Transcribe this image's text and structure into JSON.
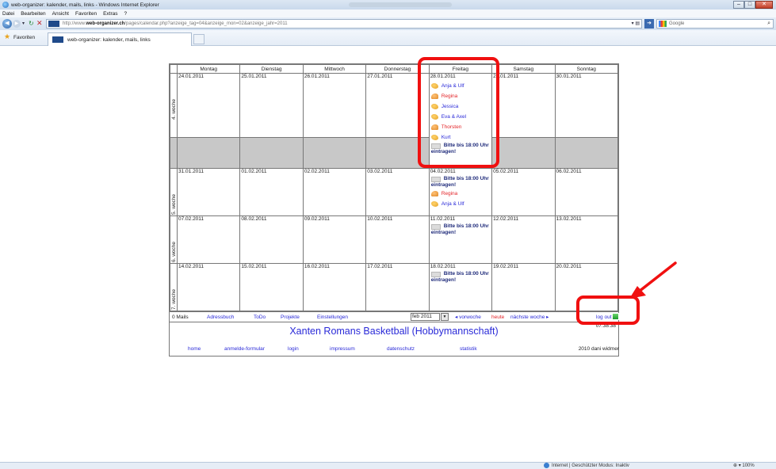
{
  "browser": {
    "window_title": "web-organizer: kalender, mails, links - Windows Internet Explorer",
    "menu": [
      "Datei",
      "Bearbeiten",
      "Ansicht",
      "Favoriten",
      "Extras",
      "?"
    ],
    "url_prefix": "http://www.",
    "url_domain": "web-organizer.ch",
    "url_path": "/pages/calendar.php?anzeige_tag=04&anzeige_mon=02&anzeige_jahr=2011",
    "search_provider": "Google",
    "favorites_label": "Favoriten",
    "tab_title": "web-organizer: kalender, mails, links",
    "status_zone": "Internet | Geschützter Modus: Inaktiv",
    "zoom": "100%"
  },
  "calendar": {
    "days": [
      "Montag",
      "Dienstag",
      "Mittwoch",
      "Donnerstag",
      "Freitag",
      "Samstag",
      "Sonntag"
    ],
    "weeks": [
      {
        "label": "4. woche",
        "dates": [
          "24.01.2011",
          "25.01.2011",
          "26.01.2011",
          "27.01.2011",
          "28.01.2011",
          "29.01.2011",
          "30.01.2011"
        ],
        "friday_entries": [
          {
            "text": "Anja & Ulf",
            "icon": "basketball-icon",
            "color": "#2a2ad8"
          },
          {
            "text": "Regina",
            "icon": "thumb-icon",
            "color": "#e3262a"
          },
          {
            "text": "Jessica",
            "icon": "basketball-icon",
            "color": "#2a2ad8"
          },
          {
            "text": "Eva & Axel",
            "icon": "basketball-icon",
            "color": "#2a2ad8"
          },
          {
            "text": "Thorsten",
            "icon": "thumb-icon",
            "color": "#e3262a"
          },
          {
            "text": "Kurt",
            "icon": "basketball-icon",
            "color": "#2a2ad8"
          }
        ],
        "friday_note_a": "Bitte bis 18:00 Uhr",
        "friday_note_b": "eintragen!"
      },
      {
        "label": "5. woche",
        "dates": [
          "31.01.2011",
          "01.02.2011",
          "02.02.2011",
          "03.02.2011",
          "04.02.2011",
          "05.02.2011",
          "06.02.2011"
        ],
        "friday_note_a": "Bitte bis 18:00 Uhr",
        "friday_note_b": "eintragen!",
        "friday_entries": [
          {
            "text": "Regina",
            "icon": "thumb-icon",
            "color": "#e3262a"
          },
          {
            "text": "Anja & Ulf",
            "icon": "basketball-icon",
            "color": "#2a2ad8"
          }
        ]
      },
      {
        "label": "6. woche",
        "dates": [
          "07.02.2011",
          "08.02.2011",
          "09.02.2011",
          "10.02.2011",
          "11.02.2011",
          "12.02.2011",
          "13.02.2011"
        ],
        "friday_note_a": "Bitte bis 18:00 Uhr",
        "friday_note_b": "eintragen!"
      },
      {
        "label": "7. woche",
        "dates": [
          "14.02.2011",
          "15.02.2011",
          "16.02.2011",
          "17.02.2011",
          "18.02.2011",
          "19.02.2011",
          "20.02.2011"
        ],
        "friday_note_a": "Bitte bis 18:00 Uhr",
        "friday_note_b": "eintragen!"
      }
    ]
  },
  "bottombar": {
    "mails": "0 Mails",
    "adressbuch": "Adressbuch",
    "todo": "ToDo",
    "projekte": "Projekte",
    "einstellungen": "Einstellungen",
    "month_select": "feb 2011",
    "vorwoche": "◂ vorwoche",
    "heute": "heute",
    "naechste": "nächste woche ▸",
    "logout": "log out",
    "time": "07:38:38"
  },
  "banner": "Xanten Romans Basketball (Hobbymannschaft)",
  "footer": {
    "home": "home",
    "anmelde": "anmelde-formular",
    "login": "login",
    "impressum": "impressum",
    "datenschutz": "datenschutz",
    "statistik": "statistik",
    "copyright": "2010 dani widmer"
  },
  "colors": {
    "annotation": "#f01010",
    "link": "#2a2ad8",
    "grey_row": "#c8c8c8"
  }
}
